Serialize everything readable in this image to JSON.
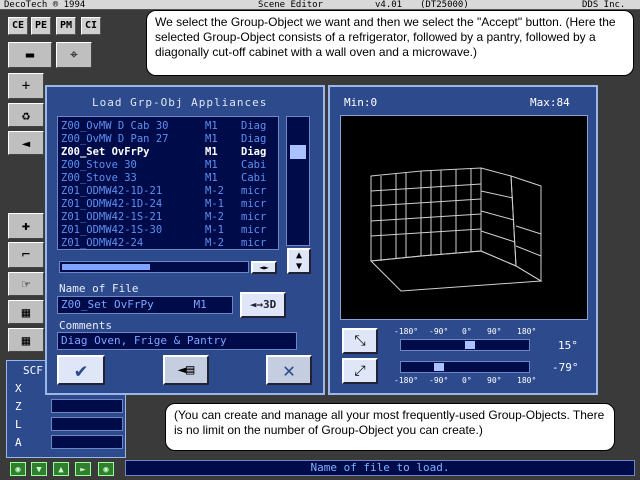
{
  "topbar": {
    "brand": "DecoTech ® 1994",
    "app": "Scene Editor",
    "version": "v4.01",
    "code": "(DT25000)",
    "company": "DDS Inc."
  },
  "toolbar": {
    "b1": "CE",
    "b2": "PE",
    "b3": "PM",
    "b4": "CI"
  },
  "callout_top": "We select the Group-Object we want and then we select the \"Accept\" button. (Here the selected Group-Object consists of a refrigerator, followed by a pantry, followed by a diagonally cut-off cabinet with a wall oven and a microwave.)",
  "callout_bottom": "(You can create and manage all your most frequently-used Group-Objects. There is no limit on the number of Group-Object you can create.)",
  "dialog": {
    "title": "Load Grp-Obj Appliances",
    "items": [
      {
        "name": "Z00_OvMW D Cab 30",
        "mod": "M1",
        "type": "Diag",
        "selected": false
      },
      {
        "name": "Z00_OvMW D Pan 27",
        "mod": "M1",
        "type": "Diag",
        "selected": false
      },
      {
        "name": "Z00_Set OvFrPy",
        "mod": "M1",
        "type": "Diag",
        "selected": true
      },
      {
        "name": "Z00_Stove 30",
        "mod": "M1",
        "type": "Cabi",
        "selected": false
      },
      {
        "name": "Z00_Stove 33",
        "mod": "M1",
        "type": "Cabi",
        "selected": false
      },
      {
        "name": "Z01_ODMW42-1D-21",
        "mod": "M-2",
        "type": "micr",
        "selected": false
      },
      {
        "name": "Z01_ODMW42-1D-24",
        "mod": "M-1",
        "type": "micr",
        "selected": false
      },
      {
        "name": "Z01_ODMW42-1S-21",
        "mod": "M-2",
        "type": "micr",
        "selected": false
      },
      {
        "name": "Z01_ODMW42-1S-30",
        "mod": "M-1",
        "type": "micr",
        "selected": false
      },
      {
        "name": "Z01_ODMW42-24",
        "mod": "M-2",
        "type": "micr",
        "selected": false
      }
    ],
    "name_label": "Name of File",
    "name_value": "Z00_Set OvFrPy      M1",
    "btn3d": "3D",
    "comments_label": "Comments",
    "comments_value": "Diag Oven, Frige & Pantry"
  },
  "preview": {
    "min_label": "Min:0",
    "max_label": "Max:84",
    "ticks": [
      "-180°",
      "-90°",
      "0°",
      "90°",
      "180°"
    ],
    "angle1": "15°",
    "angle2": "-79°",
    "slider1_fraction": 0.54,
    "slider2_fraction": 0.28
  },
  "left_panel": {
    "title": "SCF",
    "x": "X",
    "z": "Z",
    "l": "L",
    "a": "A"
  },
  "status": "Name of file to load."
}
